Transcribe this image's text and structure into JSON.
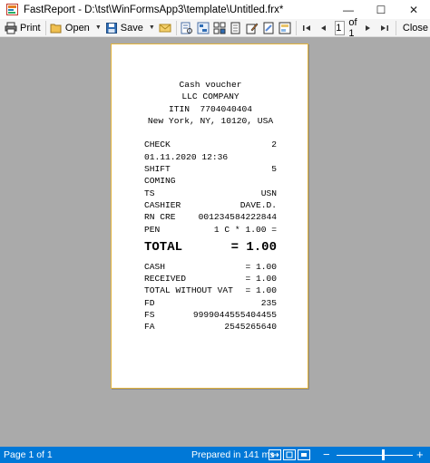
{
  "window": {
    "title": "FastReport - D:\\tst\\WinFormsApp3\\template\\Untitled.frx*",
    "minimize": "—",
    "maximize": "☐",
    "close": "✕"
  },
  "toolbar": {
    "print_label": "Print",
    "open_label": "Open",
    "save_label": "Save",
    "page_value": "1",
    "of_label": "of 1",
    "close_label": "Close"
  },
  "receipt": {
    "header": [
      "Cash voucher",
      "LLC COMPANY",
      "ITIN  7704040404",
      "New York, NY, 10120, USA"
    ],
    "check": {
      "label": "CHECK",
      "value": "2"
    },
    "datetime": "01.11.2020 12:36",
    "shift": {
      "label": "SHIFT",
      "value": "5"
    },
    "coming": "COMING",
    "ts": {
      "label": "TS",
      "value": "USN"
    },
    "cashier": {
      "label": "CASHIER",
      "value": "DAVE.D."
    },
    "rncre": {
      "label": "RN CRE",
      "value": "001234584222844"
    },
    "pen": {
      "label": "PEN",
      "value": "1 C * 1.00 ="
    },
    "total": {
      "label": "TOTAL",
      "value": "= 1.00"
    },
    "cash": {
      "label": "CASH",
      "value": "= 1.00"
    },
    "received": {
      "label": "RECEIVED",
      "value": "= 1.00"
    },
    "total_wo_vat": {
      "label": "TOTAL WITHOUT VAT",
      "value": "= 1.00"
    },
    "fd": {
      "label": "FD",
      "value": "235"
    },
    "fs": {
      "label": "FS",
      "value": "9999044555404455"
    },
    "fa": {
      "label": "FA",
      "value": "2545265640"
    }
  },
  "status": {
    "page": "Page 1 of 1",
    "prepared": "Prepared in 141 ms",
    "zoom_minus": "−",
    "zoom_plus": "+"
  },
  "colors": {
    "accent": "#0078d7",
    "preview_bg": "#aaaaaa",
    "page_border": "#e3b33a"
  }
}
